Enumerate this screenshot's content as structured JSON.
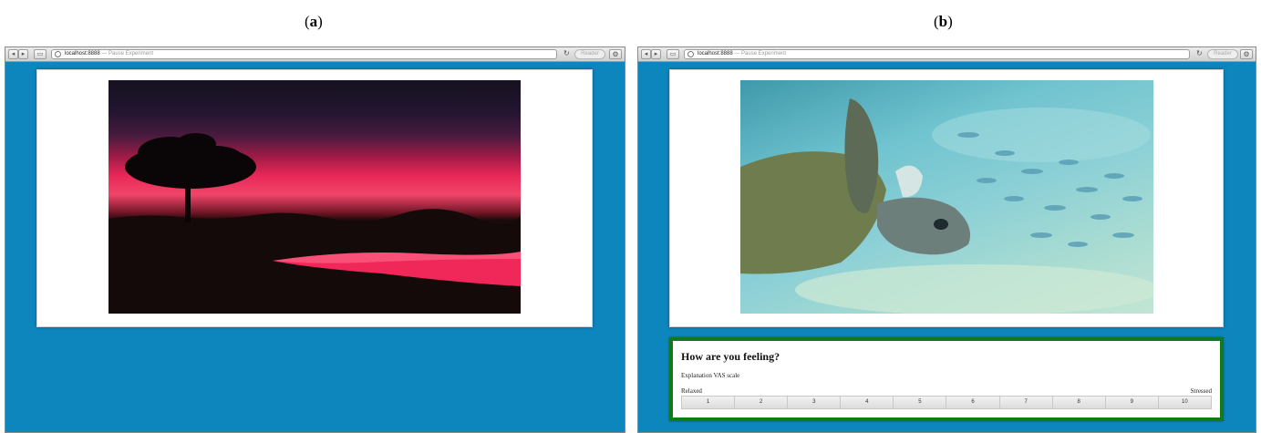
{
  "panels": [
    {
      "label": "a",
      "browser": {
        "url": "localhost:8888",
        "page_title": "— Pause Experiment",
        "reader_label": "Reader",
        "reload_icon": "reload-icon",
        "gear_icon": "gear-icon"
      },
      "image": {
        "subject": "sunset-savanna-photo"
      }
    },
    {
      "label": "b",
      "browser": {
        "url": "localhost:8888",
        "page_title": "— Pause Experiment",
        "reader_label": "Reader",
        "reload_icon": "reload-icon",
        "gear_icon": "gear-icon"
      },
      "image": {
        "subject": "sea-turtle-photo"
      },
      "survey": {
        "question": "How are you feeling?",
        "explanation": "Explanation VAS scale",
        "left_anchor": "Relaxed",
        "right_anchor": "Stressed",
        "options": [
          "1",
          "2",
          "3",
          "4",
          "5",
          "6",
          "7",
          "8",
          "9",
          "10"
        ]
      }
    }
  ],
  "colors": {
    "page_background": "#0d85bd",
    "survey_border": "#117a1a"
  }
}
